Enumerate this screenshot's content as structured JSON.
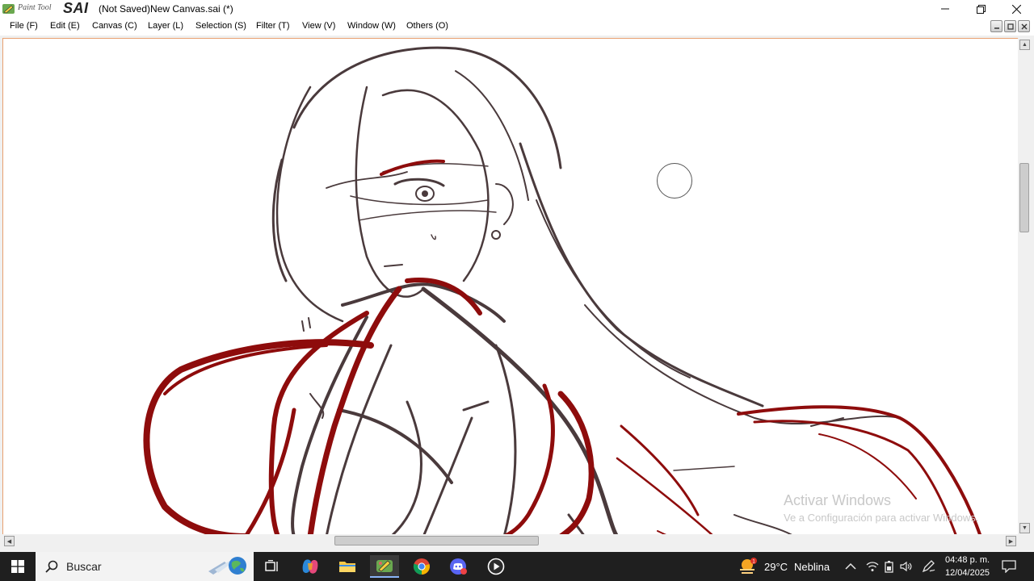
{
  "app": {
    "logo_small": "Paint Tool",
    "logo_big": "SAI",
    "window_title": "(Not Saved)New Canvas.sai (*)"
  },
  "menu": [
    {
      "label": "File (F)"
    },
    {
      "label": "Edit (E)"
    },
    {
      "label": "Canvas (C)"
    },
    {
      "label": "Layer (L)"
    },
    {
      "label": "Selection (S)"
    },
    {
      "label": "Filter (T)"
    },
    {
      "label": "View (V)"
    },
    {
      "label": "Window (W)"
    },
    {
      "label": "Others (O)"
    }
  ],
  "watermark": {
    "title": "Activar Windows",
    "subtitle": "Ve a Configuración para activar Windows."
  },
  "scroll": {
    "vertical_position": 0.25,
    "horizontal_position": 0.33
  },
  "taskbar": {
    "search_label": "Buscar",
    "weather_temp": "29°C",
    "weather_desc": "Neblina",
    "weather_badge": "1",
    "time": "04:48 p. m.",
    "date": "12/04/2025"
  },
  "colors": {
    "sketch_dark": "#4a3a3c",
    "sketch_red": "#8e0c0c",
    "canvas_accent": "#e8a070",
    "taskbar_bg": "#1f1f1f"
  },
  "icons": {
    "start": "windows-logo-icon",
    "search": "search-icon",
    "task_view": "task-view-icon",
    "copilot": "copilot-icon",
    "explorer": "folder-icon",
    "paint_tool_sai": "sai-icon",
    "chrome": "chrome-icon",
    "discord": "discord-icon",
    "media": "media-player-icon"
  }
}
